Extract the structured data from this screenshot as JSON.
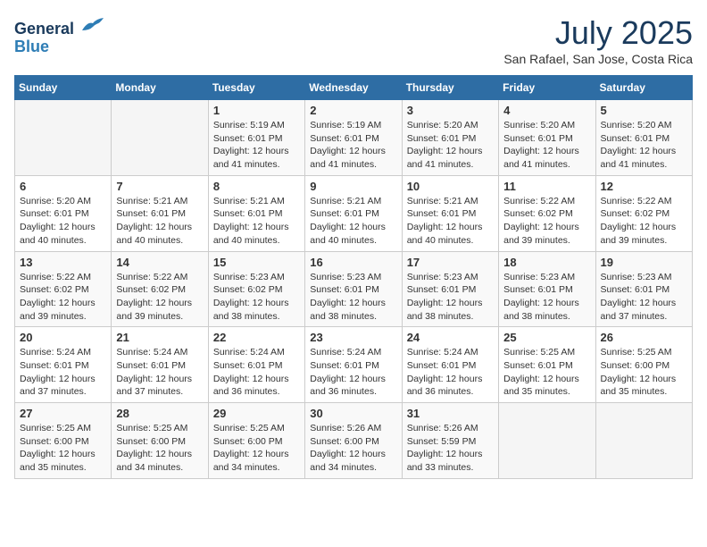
{
  "header": {
    "logo_line1": "General",
    "logo_line2": "Blue",
    "month_title": "July 2025",
    "location": "San Rafael, San Jose, Costa Rica"
  },
  "weekdays": [
    "Sunday",
    "Monday",
    "Tuesday",
    "Wednesday",
    "Thursday",
    "Friday",
    "Saturday"
  ],
  "weeks": [
    [
      {
        "day": "",
        "info": ""
      },
      {
        "day": "",
        "info": ""
      },
      {
        "day": "1",
        "info": "Sunrise: 5:19 AM\nSunset: 6:01 PM\nDaylight: 12 hours and 41 minutes."
      },
      {
        "day": "2",
        "info": "Sunrise: 5:19 AM\nSunset: 6:01 PM\nDaylight: 12 hours and 41 minutes."
      },
      {
        "day": "3",
        "info": "Sunrise: 5:20 AM\nSunset: 6:01 PM\nDaylight: 12 hours and 41 minutes."
      },
      {
        "day": "4",
        "info": "Sunrise: 5:20 AM\nSunset: 6:01 PM\nDaylight: 12 hours and 41 minutes."
      },
      {
        "day": "5",
        "info": "Sunrise: 5:20 AM\nSunset: 6:01 PM\nDaylight: 12 hours and 41 minutes."
      }
    ],
    [
      {
        "day": "6",
        "info": "Sunrise: 5:20 AM\nSunset: 6:01 PM\nDaylight: 12 hours and 40 minutes."
      },
      {
        "day": "7",
        "info": "Sunrise: 5:21 AM\nSunset: 6:01 PM\nDaylight: 12 hours and 40 minutes."
      },
      {
        "day": "8",
        "info": "Sunrise: 5:21 AM\nSunset: 6:01 PM\nDaylight: 12 hours and 40 minutes."
      },
      {
        "day": "9",
        "info": "Sunrise: 5:21 AM\nSunset: 6:01 PM\nDaylight: 12 hours and 40 minutes."
      },
      {
        "day": "10",
        "info": "Sunrise: 5:21 AM\nSunset: 6:01 PM\nDaylight: 12 hours and 40 minutes."
      },
      {
        "day": "11",
        "info": "Sunrise: 5:22 AM\nSunset: 6:02 PM\nDaylight: 12 hours and 39 minutes."
      },
      {
        "day": "12",
        "info": "Sunrise: 5:22 AM\nSunset: 6:02 PM\nDaylight: 12 hours and 39 minutes."
      }
    ],
    [
      {
        "day": "13",
        "info": "Sunrise: 5:22 AM\nSunset: 6:02 PM\nDaylight: 12 hours and 39 minutes."
      },
      {
        "day": "14",
        "info": "Sunrise: 5:22 AM\nSunset: 6:02 PM\nDaylight: 12 hours and 39 minutes."
      },
      {
        "day": "15",
        "info": "Sunrise: 5:23 AM\nSunset: 6:02 PM\nDaylight: 12 hours and 38 minutes."
      },
      {
        "day": "16",
        "info": "Sunrise: 5:23 AM\nSunset: 6:01 PM\nDaylight: 12 hours and 38 minutes."
      },
      {
        "day": "17",
        "info": "Sunrise: 5:23 AM\nSunset: 6:01 PM\nDaylight: 12 hours and 38 minutes."
      },
      {
        "day": "18",
        "info": "Sunrise: 5:23 AM\nSunset: 6:01 PM\nDaylight: 12 hours and 38 minutes."
      },
      {
        "day": "19",
        "info": "Sunrise: 5:23 AM\nSunset: 6:01 PM\nDaylight: 12 hours and 37 minutes."
      }
    ],
    [
      {
        "day": "20",
        "info": "Sunrise: 5:24 AM\nSunset: 6:01 PM\nDaylight: 12 hours and 37 minutes."
      },
      {
        "day": "21",
        "info": "Sunrise: 5:24 AM\nSunset: 6:01 PM\nDaylight: 12 hours and 37 minutes."
      },
      {
        "day": "22",
        "info": "Sunrise: 5:24 AM\nSunset: 6:01 PM\nDaylight: 12 hours and 36 minutes."
      },
      {
        "day": "23",
        "info": "Sunrise: 5:24 AM\nSunset: 6:01 PM\nDaylight: 12 hours and 36 minutes."
      },
      {
        "day": "24",
        "info": "Sunrise: 5:24 AM\nSunset: 6:01 PM\nDaylight: 12 hours and 36 minutes."
      },
      {
        "day": "25",
        "info": "Sunrise: 5:25 AM\nSunset: 6:01 PM\nDaylight: 12 hours and 35 minutes."
      },
      {
        "day": "26",
        "info": "Sunrise: 5:25 AM\nSunset: 6:00 PM\nDaylight: 12 hours and 35 minutes."
      }
    ],
    [
      {
        "day": "27",
        "info": "Sunrise: 5:25 AM\nSunset: 6:00 PM\nDaylight: 12 hours and 35 minutes."
      },
      {
        "day": "28",
        "info": "Sunrise: 5:25 AM\nSunset: 6:00 PM\nDaylight: 12 hours and 34 minutes."
      },
      {
        "day": "29",
        "info": "Sunrise: 5:25 AM\nSunset: 6:00 PM\nDaylight: 12 hours and 34 minutes."
      },
      {
        "day": "30",
        "info": "Sunrise: 5:26 AM\nSunset: 6:00 PM\nDaylight: 12 hours and 34 minutes."
      },
      {
        "day": "31",
        "info": "Sunrise: 5:26 AM\nSunset: 5:59 PM\nDaylight: 12 hours and 33 minutes."
      },
      {
        "day": "",
        "info": ""
      },
      {
        "day": "",
        "info": ""
      }
    ]
  ]
}
